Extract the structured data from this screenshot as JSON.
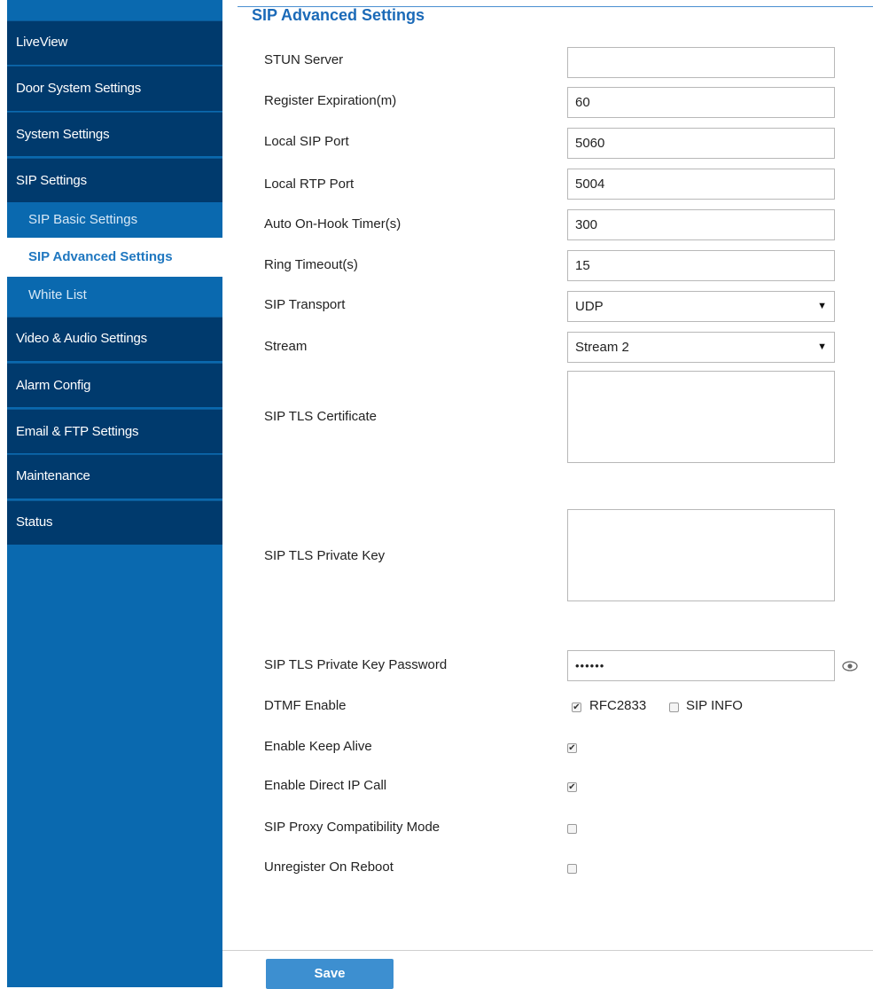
{
  "sidebar": {
    "items": [
      {
        "label": "LiveView"
      },
      {
        "label": "Door System Settings"
      },
      {
        "label": "System Settings"
      },
      {
        "label": "SIP Settings"
      },
      {
        "label": "Video & Audio Settings"
      },
      {
        "label": "Alarm Config"
      },
      {
        "label": "Email & FTP Settings"
      },
      {
        "label": "Maintenance"
      },
      {
        "label": "Status"
      }
    ],
    "subitems": [
      {
        "label": "SIP Basic Settings"
      },
      {
        "label": "SIP Advanced Settings",
        "active": true
      },
      {
        "label": "White List"
      }
    ]
  },
  "page": {
    "title": "SIP Advanced Settings"
  },
  "form": {
    "stun_server": {
      "label": "STUN Server",
      "value": ""
    },
    "register_expiration": {
      "label": "Register Expiration(m)",
      "value": "60"
    },
    "local_sip_port": {
      "label": "Local SIP Port",
      "value": "5060"
    },
    "local_rtp_port": {
      "label": "Local RTP Port",
      "value": "5004"
    },
    "auto_onhook": {
      "label": "Auto On-Hook Timer(s)",
      "value": "300"
    },
    "ring_timeout": {
      "label": "Ring Timeout(s)",
      "value": "15"
    },
    "sip_transport": {
      "label": "SIP Transport",
      "value": "UDP"
    },
    "stream": {
      "label": "Stream",
      "value": "Stream 2"
    },
    "tls_certificate": {
      "label": "SIP TLS Certificate"
    },
    "tls_private_key": {
      "label": "SIP TLS Private Key"
    },
    "tls_key_password": {
      "label": "SIP TLS Private Key Password",
      "value": "••••••"
    },
    "dtmf": {
      "label": "DTMF Enable",
      "rfc2833": "RFC2833",
      "rfc2833_checked": true,
      "sip_info": "SIP INFO",
      "sip_info_checked": false
    },
    "keep_alive": {
      "label": "Enable Keep Alive",
      "checked": true
    },
    "direct_ip_call": {
      "label": "Enable Direct IP Call",
      "checked": true
    },
    "proxy_compat": {
      "label": "SIP Proxy Compatibility Mode",
      "checked": false
    },
    "unregister_reboot": {
      "label": "Unregister On Reboot",
      "checked": false
    }
  },
  "actions": {
    "save_label": "Save"
  },
  "icons": {
    "caret": "▼",
    "check": "✔",
    "eye": "eye-icon"
  },
  "colors": {
    "sidebar_bg": "#0a69af",
    "sidebar_item_bg": "#003a6d",
    "accent": "#1b6ab8",
    "save_button": "#3d8fd0"
  }
}
